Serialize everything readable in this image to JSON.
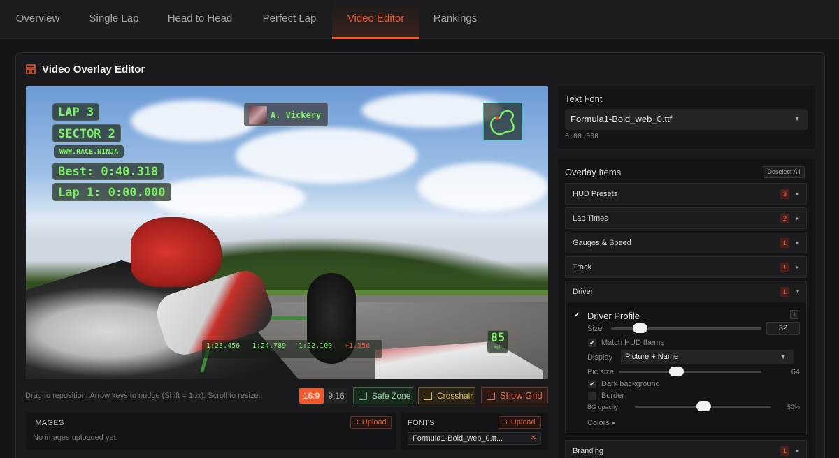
{
  "tabs": [
    "Overview",
    "Single Lap",
    "Head to Head",
    "Perfect Lap",
    "Video Editor",
    "Rankings"
  ],
  "active_tab": "Video Editor",
  "colors": {
    "accent": "#ee5a2c",
    "hud_green": "#7ef264",
    "panel_bg": "#141416"
  },
  "editor": {
    "title": "Video Overlay Editor",
    "hint": "Drag to reposition. Arrow keys to nudge (Shift = 1px). Scroll to resize.",
    "aspect_options": [
      "16:9",
      "9:16"
    ],
    "aspect_selected": "16:9",
    "toggles": {
      "safe_zone": "Safe Zone",
      "crosshair": "Crosshair",
      "show_grid": "Show Grid"
    }
  },
  "preview": {
    "lap": "LAP 3",
    "sector": "SECTOR 2",
    "site": "WWW.RACE.NINJA",
    "best": "Best: 0:40.318",
    "current_lap": "Lap 1: 0:00.000",
    "driver_name": "A. Vickery",
    "speed": "85",
    "speed_unit": "mph",
    "sectors": [
      "1:23.456",
      "1:24.789",
      "1:22.100",
      "+1.356"
    ]
  },
  "images": {
    "label": "IMAGES",
    "upload": "+ Upload",
    "empty": "No images uploaded yet."
  },
  "fonts": {
    "label": "FONTS",
    "upload": "+ Upload",
    "file": "Formula1-Bold_web_0.tt..."
  },
  "text_font": {
    "label": "Text Font",
    "selected": "Formula1-Bold_web_0.ttf",
    "preview": "0:00.000"
  },
  "overlay_items": {
    "title": "Overlay Items",
    "deselect": "Deselect All",
    "groups": [
      {
        "label": "HUD Presets",
        "count": "3"
      },
      {
        "label": "Lap Times",
        "count": "2"
      },
      {
        "label": "Gauges & Speed",
        "count": "1"
      },
      {
        "label": "Track",
        "count": "1"
      },
      {
        "label": "Driver",
        "count": "1"
      },
      {
        "label": "Branding",
        "count": "1"
      }
    ],
    "driver_profile": {
      "title": "Driver Profile",
      "size_label": "Size",
      "size_value": "32",
      "size_fraction": 0.19,
      "match_theme": "Match HUD theme",
      "display_label": "Display",
      "display_value": "Picture + Name",
      "pic_size_label": "Pic size",
      "pic_size_value": "64",
      "pic_size_fraction": 0.4,
      "dark_bg": "Dark background",
      "border": "Border",
      "bg_opacity_label": "BG opacity",
      "bg_opacity_value": "50%",
      "bg_opacity_fraction": 0.5,
      "colors_label": "Colors ▸"
    }
  }
}
